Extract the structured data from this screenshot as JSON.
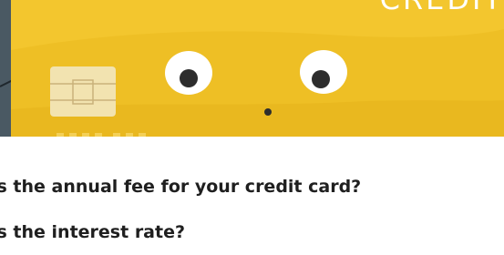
{
  "card": {
    "label": "CREDIT",
    "colors": {
      "card_yellow": "#f3c62e",
      "card_shadow": "#e8b71f",
      "chip": "#f2e3b0",
      "eye_pupil": "#2d2d2d",
      "background_slate": "#4a5963"
    },
    "icons": [
      "chip-icon",
      "left-eye-icon",
      "right-eye-icon",
      "nose-dot-icon"
    ]
  },
  "faq": {
    "questions": [
      "is the annual fee for your credit card?",
      "is the interest rate?"
    ]
  }
}
